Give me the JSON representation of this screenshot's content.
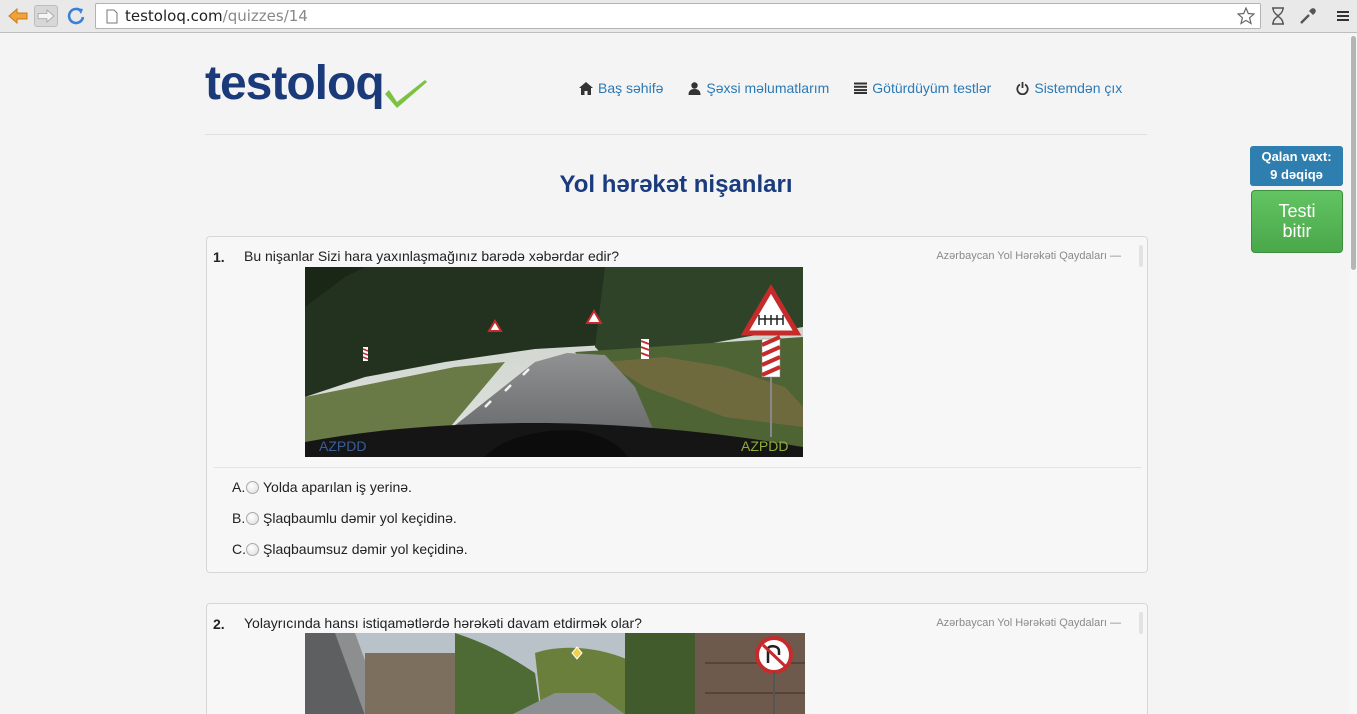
{
  "browser": {
    "url_host": "testoloq.com",
    "url_path": "/quizzes/14"
  },
  "header": {
    "logo_text": "testoloq",
    "nav": [
      {
        "label": "Baş səhifə",
        "icon": "home-icon"
      },
      {
        "label": "Şəxsi məlumatlarım",
        "icon": "user-icon"
      },
      {
        "label": "Götürdüyüm testlər",
        "icon": "list-icon"
      },
      {
        "label": "Sistemdən çıx",
        "icon": "power-icon"
      }
    ]
  },
  "page": {
    "title": "Yol hərəkət nişanları"
  },
  "timer": {
    "label": "Qalan vaxt:",
    "value": "9 dəqiqə"
  },
  "finish_button": {
    "line1": "Testi",
    "line2": "bitir"
  },
  "questions": [
    {
      "number": "1.",
      "text": "Bu nişanlar Sizi hara yaxınlaşmağınız barədə xəbərdar edir?",
      "source": "Azərbaycan Yol Hərəkəti Qaydaları —",
      "image_watermark": "AZPDD",
      "answers": [
        {
          "letter": "A.",
          "text": "Yolda aparılan iş yerinə."
        },
        {
          "letter": "B.",
          "text": "Şlaqbaumlu dəmir yol keçidinə."
        },
        {
          "letter": "C.",
          "text": "Şlaqbaumsuz dəmir yol keçidinə."
        }
      ]
    },
    {
      "number": "2.",
      "text": "Yolayrıcında hansı istiqamətlərdə hərəkəti davam etdirmək olar?",
      "source": "Azərbaycan Yol Hərəkəti Qaydaları —"
    }
  ],
  "colors": {
    "brand_navy": "#1a3a7a",
    "link_blue": "#2a7ab5",
    "timer_blue": "#2e7eaf",
    "finish_green": "#5cb85c",
    "check_green": "#7cc242"
  }
}
